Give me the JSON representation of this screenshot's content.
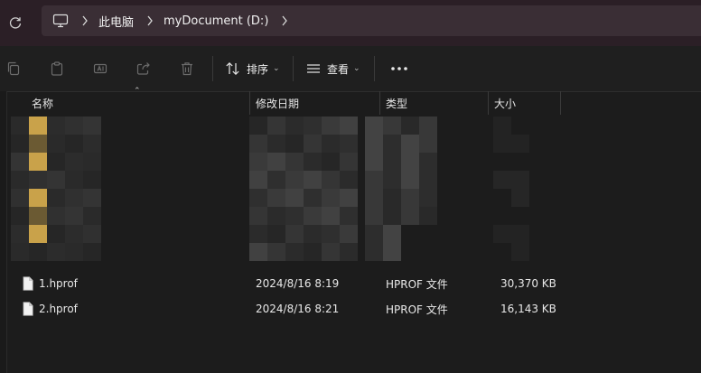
{
  "address": {
    "crumbs": [
      "此电脑",
      "myDocument (D:)"
    ]
  },
  "toolbar": {
    "sort_label": "排序",
    "view_label": "查看"
  },
  "columns": {
    "name": "名称",
    "modified": "修改日期",
    "type": "类型",
    "size": "大小"
  },
  "files": [
    {
      "name": "1.hprof",
      "modified": "2024/8/16 8:19",
      "type": "HPROF 文件",
      "size": "30,370 KB"
    },
    {
      "name": "2.hprof",
      "modified": "2024/8/16 8:21",
      "type": "HPROF 文件",
      "size": "16,143 KB"
    }
  ],
  "colors": {
    "address_bg": "#2b1f26",
    "window_bg": "#1c1c1c",
    "folder_yellow": "#c9a24a"
  }
}
